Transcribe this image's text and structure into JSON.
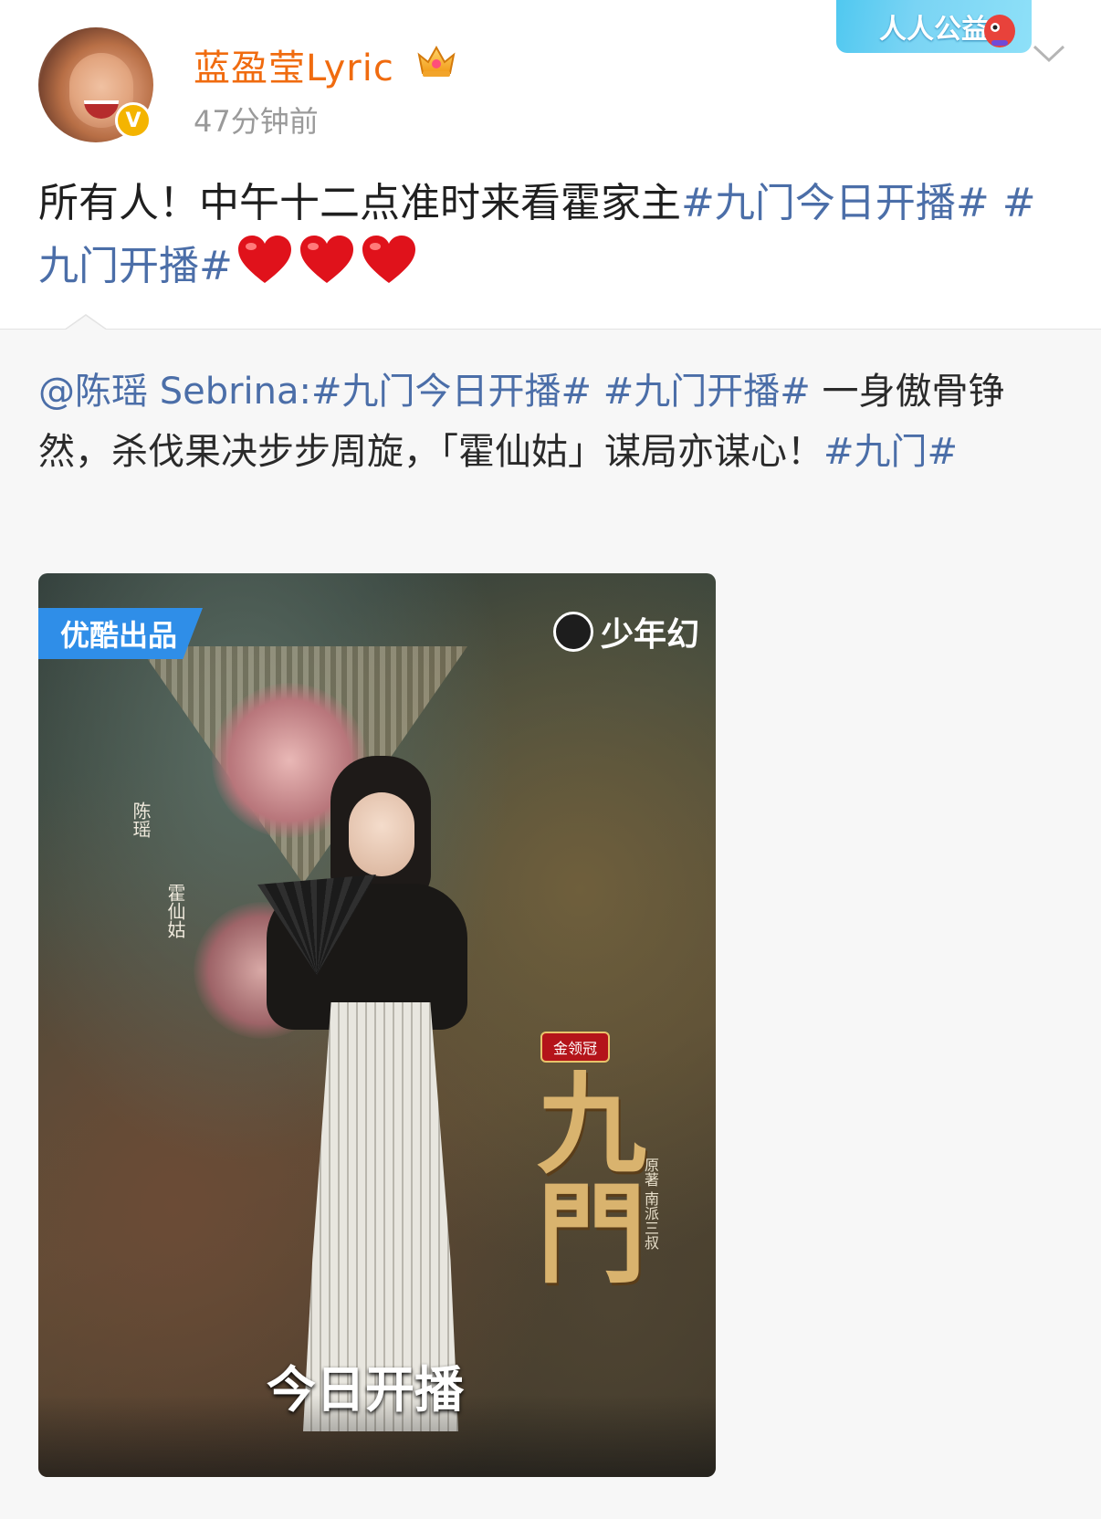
{
  "header": {
    "username": "蓝盈莹Lyric",
    "time": "47分钟前",
    "badge_label": "人人公益",
    "verify_symbol": "V"
  },
  "post": {
    "text": "所有人！中午十二点准时来看霍家主",
    "tag1": "#九门今日开播#",
    "tag2": "#九门开播#",
    "hearts_count": 3
  },
  "repost": {
    "mention": "@陈瑶 Sebrina:",
    "tag1": "#九门今日开播#",
    "tag2": "#九门开播#",
    "body": "一身傲骨铮然，杀伐果决步步周旋，「霍仙姑」谋局亦谋心！",
    "tag3": "#九门#"
  },
  "poster": {
    "corner_tag": "优酷出品",
    "logo": "少年幻",
    "actor_name": "陈瑶",
    "role_name": "霍仙姑",
    "brand": "金领冠",
    "title": "九門",
    "author": "原著 南派三叔",
    "air_text": "今日开播"
  },
  "colors": {
    "username": "#f06b0f",
    "tag": "#4b6ea8",
    "time": "#9a9a9a"
  },
  "icons": [
    "crown-icon",
    "chevron-down-icon",
    "verified-badge-icon",
    "heart-icon"
  ]
}
